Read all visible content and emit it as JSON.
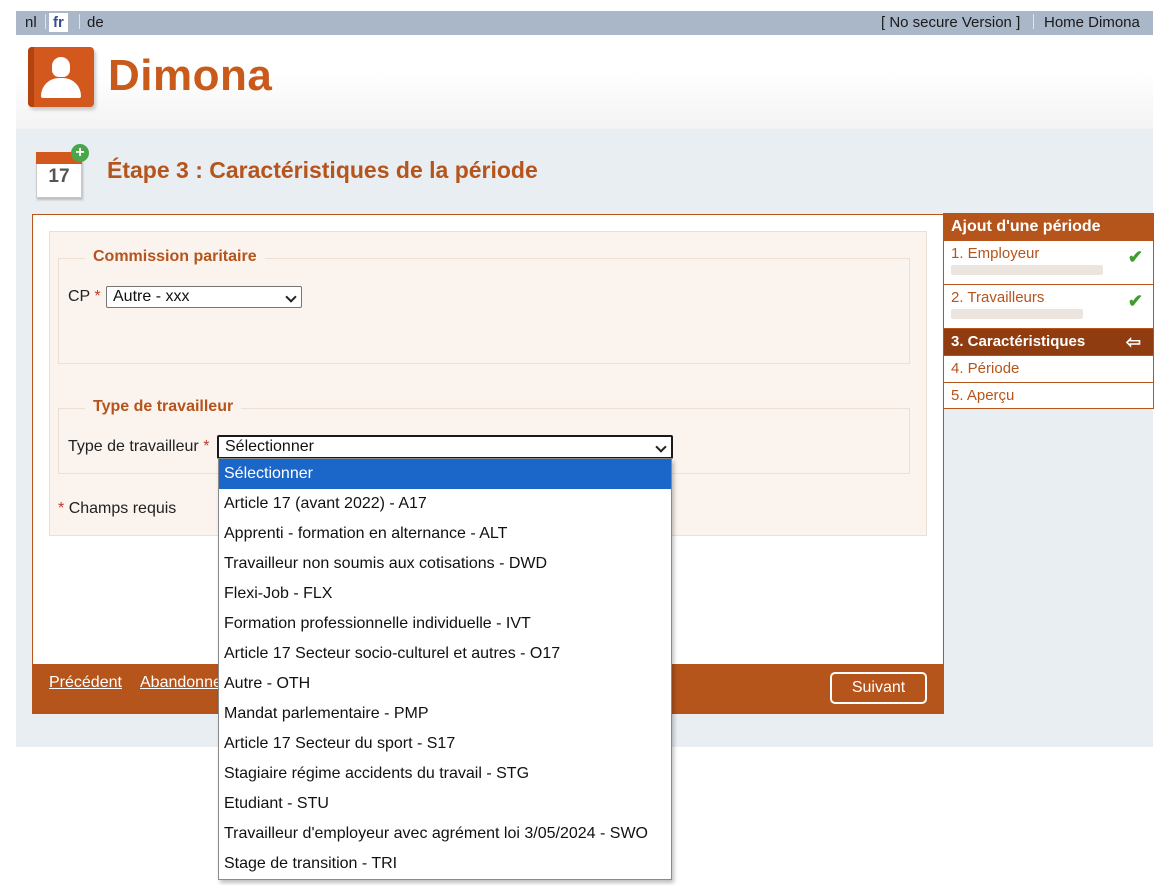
{
  "topbar": {
    "languages": [
      "nl",
      "fr",
      "de"
    ],
    "active_language": "fr",
    "no_secure": "[ No secure Version ]",
    "home": "Home Dimona"
  },
  "logo": {
    "text": "Dimona",
    "icon": "user-card-icon"
  },
  "page": {
    "title": "Étape 3 : Caractéristiques de la période",
    "calendar_day": "17",
    "calendar_icon": "calendar-add-icon"
  },
  "form": {
    "cp_legend": "Commission paritaire",
    "cp_label": "CP",
    "cp_value": "Autre - xxx",
    "worker_legend": "Type de travailleur",
    "worker_label": "Type de travailleur",
    "worker_value": "Sélectionner",
    "required_marker": "*",
    "required_note": "Champs requis"
  },
  "footer": {
    "previous": "Précédent",
    "abandon": "Abandonner",
    "next": "Suivant"
  },
  "sidebar": {
    "title": "Ajout d'une période",
    "steps": [
      {
        "label": "1. Employeur",
        "done": true
      },
      {
        "label": "2. Travailleurs",
        "done": true
      },
      {
        "label": "3. Caractéristiques",
        "current": true
      },
      {
        "label": "4. Période"
      },
      {
        "label": "5. Aperçu"
      }
    ]
  },
  "dropdown": {
    "options": [
      "Sélectionner",
      "Article 17 (avant 2022) - A17",
      "Apprenti - formation en alternance - ALT",
      "Travailleur non soumis aux cotisations - DWD",
      "Flexi-Job - FLX",
      "Formation professionnelle individuelle - IVT",
      "Article 17 Secteur socio-culturel et autres - O17",
      "Autre - OTH",
      "Mandat parlementaire - PMP",
      "Article 17 Secteur du sport - S17",
      "Stagiaire régime accidents du travail - STG",
      "Etudiant - STU",
      "Travailleur d'employeur avec agrément loi 3/05/2024 - SWO",
      "Stage de transition - TRI"
    ],
    "highlighted": "Sélectionner"
  },
  "colors": {
    "brand": "#b5541b",
    "topbar": "#a9b7c9",
    "highlight": "#1b66c9",
    "check": "#3f9e2e"
  }
}
